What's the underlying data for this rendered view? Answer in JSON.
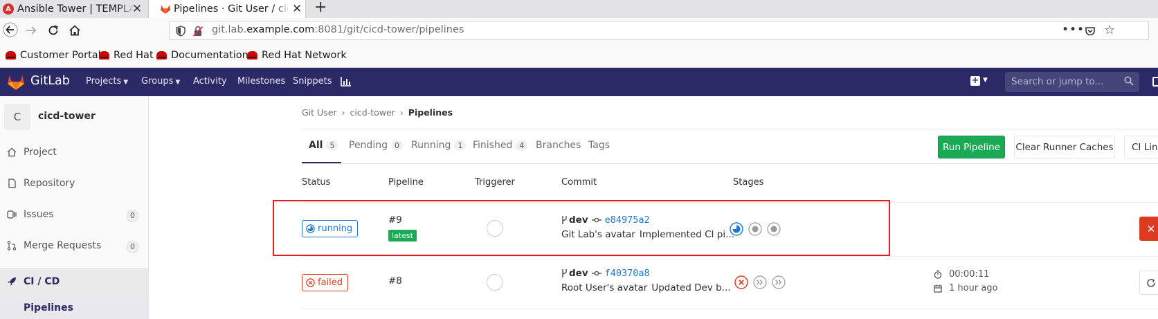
{
  "browser": {
    "tabs": [
      {
        "title": "Ansible Tower | TEMPLATES"
      },
      {
        "title": "Pipelines · Git User / cicd-tower"
      }
    ],
    "url": {
      "prefix": "git.lab.",
      "domain": "example.com",
      "suffix": ":8081/git/cicd-tower/pipelines"
    },
    "bookmarks": [
      "Customer Portal",
      "Red Hat",
      "Documentation",
      "Red Hat Network"
    ]
  },
  "gitlab_header": {
    "brand": "GitLab",
    "nav": [
      "Projects",
      "Groups",
      "Activity",
      "Milestones",
      "Snippets"
    ],
    "search_placeholder": "Search or jump to..."
  },
  "sidebar": {
    "project_initial": "C",
    "project_name": "cicd-tower",
    "items": [
      {
        "label": "Project",
        "icon": "home-icon"
      },
      {
        "label": "Repository",
        "icon": "file-icon"
      },
      {
        "label": "Issues",
        "icon": "issues-icon",
        "count": "0"
      },
      {
        "label": "Merge Requests",
        "icon": "merge-request-icon",
        "count": "0"
      },
      {
        "label": "CI / CD",
        "icon": "rocket-icon"
      }
    ],
    "subitem": "Pipelines"
  },
  "breadcrumb": [
    "Git User",
    "cicd-tower",
    "Pipelines"
  ],
  "pipeline_tabs": [
    {
      "label": "All",
      "count": "5"
    },
    {
      "label": "Pending",
      "count": "0"
    },
    {
      "label": "Running",
      "count": "1"
    },
    {
      "label": "Finished",
      "count": "4"
    },
    {
      "label": "Branches"
    },
    {
      "label": "Tags"
    }
  ],
  "buttons": {
    "run": "Run Pipeline",
    "clear": "Clear Runner Caches",
    "lint": "CI Lint"
  },
  "columns": [
    "Status",
    "Pipeline",
    "Triggerer",
    "Commit",
    "Stages"
  ],
  "pipelines": [
    {
      "status": "running",
      "id": "#9",
      "badge": "latest",
      "branch": "dev",
      "sha": "e84975a2",
      "author": "Git Lab's avatar",
      "message": "Implemented CI pi...",
      "stages": [
        "running",
        "created",
        "created"
      ],
      "duration": "",
      "finished": ""
    },
    {
      "status": "failed",
      "id": "#8",
      "badge": "",
      "branch": "dev",
      "sha": "f40370a8",
      "author": "Root User's avatar",
      "message": "Updated Dev b...",
      "stages": [
        "failed",
        "skipped",
        "skipped"
      ],
      "duration": "00:00:11",
      "finished": "1 hour ago"
    }
  ],
  "colors": {
    "header": "#2b2a66",
    "success": "#1aaa55",
    "running": "#1f78d1",
    "failed": "#db3b21",
    "highlight": "#e02020"
  }
}
